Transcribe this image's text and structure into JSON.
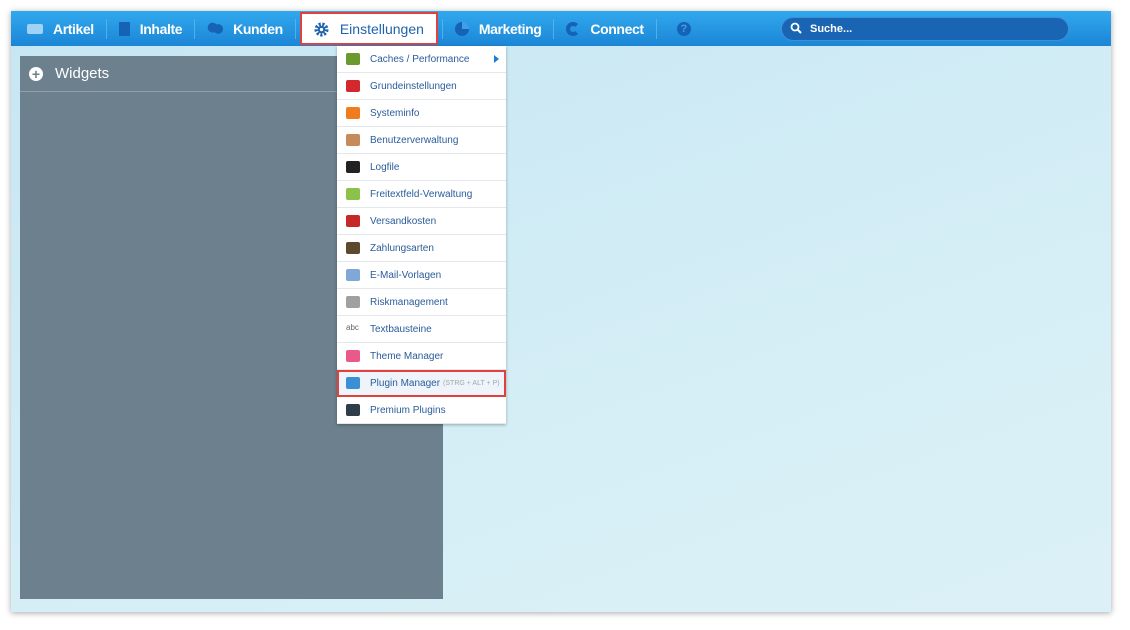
{
  "nav": {
    "items": [
      {
        "label": "Artikel",
        "icon": "mail-icon"
      },
      {
        "label": "Inhalte",
        "icon": "document-icon"
      },
      {
        "label": "Kunden",
        "icon": "users-icon"
      },
      {
        "label": "Einstellungen",
        "icon": "gear-icon"
      },
      {
        "label": "Marketing",
        "icon": "pie-chart-icon"
      },
      {
        "label": "Connect",
        "icon": "connect-icon"
      }
    ],
    "help": "?",
    "search_placeholder": "Suche..."
  },
  "widgets": {
    "title": "Widgets"
  },
  "menu": {
    "items": [
      {
        "label": "Caches / Performance",
        "color": "#6a9a2e"
      },
      {
        "label": "Grundeinstellungen",
        "color": "#d3282c"
      },
      {
        "label": "Systeminfo",
        "color": "#f07c1e"
      },
      {
        "label": "Benutzerverwaltung",
        "color": "#c78a5a"
      },
      {
        "label": "Logfile",
        "color": "#222"
      },
      {
        "label": "Freitextfeld-Verwaltung",
        "color": "#8bc34a"
      },
      {
        "label": "Versandkosten",
        "color": "#c62828"
      },
      {
        "label": "Zahlungsarten",
        "color": "#5d4a2e"
      },
      {
        "label": "E-Mail-Vorlagen",
        "color": "#7fa8d8"
      },
      {
        "label": "Riskmanagement",
        "color": "#a0a0a0"
      },
      {
        "label": "Textbausteine",
        "color": "#fff"
      },
      {
        "label": "Theme Manager",
        "color": "#e85a8a"
      },
      {
        "label": "Plugin Manager",
        "shortcut": "(STRG + ALT + P)",
        "color": "#3a8fd6"
      },
      {
        "label": "Premium Plugins",
        "color": "#2d3e4a"
      }
    ]
  }
}
